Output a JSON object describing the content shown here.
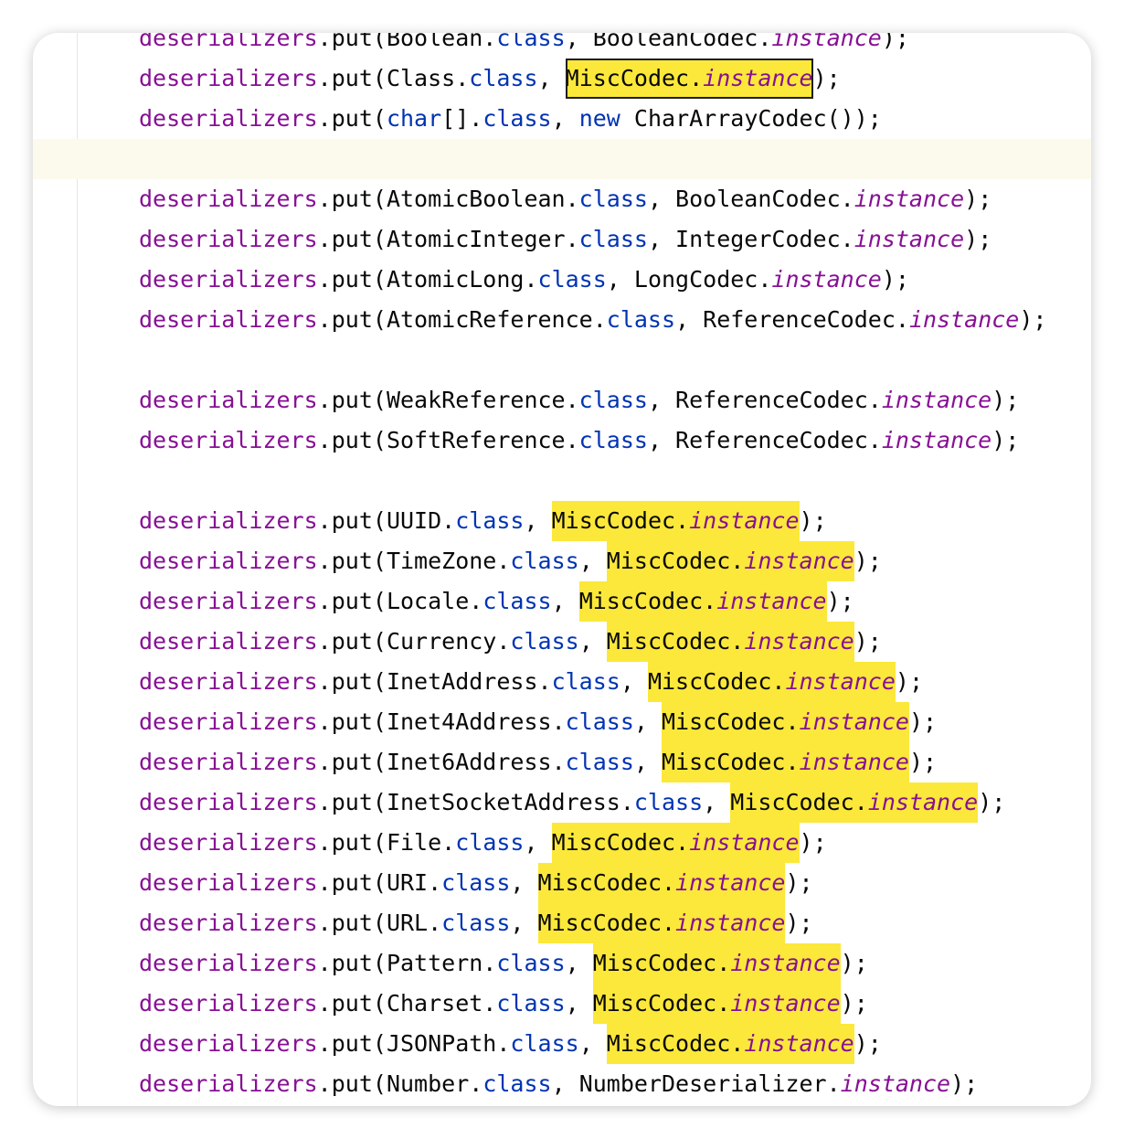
{
  "code_lines": [
    {
      "var": "deserializers",
      "call": ".put(",
      "type": "Boolean",
      "dot": ".",
      "cls": "class",
      "sep": ", ",
      "codec": "BooleanCodec.",
      "field": "instance",
      "end": ");",
      "kw_prefix": "",
      "highlight": "none"
    },
    {
      "var": "deserializers",
      "call": ".put(",
      "type": "Class",
      "dot": ".",
      "cls": "class",
      "sep": ", ",
      "codec": "MiscCodec.",
      "field": "instance",
      "end": ");",
      "kw_prefix": "",
      "highlight": "selected"
    },
    {
      "var": "deserializers",
      "call": ".put(",
      "type_kw": "char",
      "type": "[]",
      "dot": ".",
      "cls": "class",
      "sep": ", ",
      "new_kw": "new",
      "codec_new": " CharArrayCodec()",
      "end": ");",
      "highlight": "none"
    },
    {
      "blank": true,
      "current": true
    },
    {
      "var": "deserializers",
      "call": ".put(",
      "type": "AtomicBoolean",
      "dot": ".",
      "cls": "class",
      "sep": ", ",
      "codec": "BooleanCodec.",
      "field": "instance",
      "end": ");",
      "highlight": "none"
    },
    {
      "var": "deserializers",
      "call": ".put(",
      "type": "AtomicInteger",
      "dot": ".",
      "cls": "class",
      "sep": ", ",
      "codec": "IntegerCodec.",
      "field": "instance",
      "end": ");",
      "highlight": "none"
    },
    {
      "var": "deserializers",
      "call": ".put(",
      "type": "AtomicLong",
      "dot": ".",
      "cls": "class",
      "sep": ", ",
      "codec": "LongCodec.",
      "field": "instance",
      "end": ");",
      "highlight": "none"
    },
    {
      "var": "deserializers",
      "call": ".put(",
      "type": "AtomicReference",
      "dot": ".",
      "cls": "class",
      "sep": ", ",
      "codec": "ReferenceCodec.",
      "field": "instance",
      "end": ");",
      "highlight": "none"
    },
    {
      "blank": true
    },
    {
      "var": "deserializers",
      "call": ".put(",
      "type": "WeakReference",
      "dot": ".",
      "cls": "class",
      "sep": ", ",
      "codec": "ReferenceCodec.",
      "field": "instance",
      "end": ");",
      "highlight": "none"
    },
    {
      "var": "deserializers",
      "call": ".put(",
      "type": "SoftReference",
      "dot": ".",
      "cls": "class",
      "sep": ", ",
      "codec": "ReferenceCodec.",
      "field": "instance",
      "end": ");",
      "highlight": "none"
    },
    {
      "blank": true
    },
    {
      "var": "deserializers",
      "call": ".put(",
      "type": "UUID",
      "dot": ".",
      "cls": "class",
      "sep": ", ",
      "codec": "MiscCodec.",
      "field": "instance",
      "end": ");",
      "highlight": "yellow"
    },
    {
      "var": "deserializers",
      "call": ".put(",
      "type": "TimeZone",
      "dot": ".",
      "cls": "class",
      "sep": ", ",
      "codec": "MiscCodec.",
      "field": "instance",
      "end": ");",
      "highlight": "yellow"
    },
    {
      "var": "deserializers",
      "call": ".put(",
      "type": "Locale",
      "dot": ".",
      "cls": "class",
      "sep": ", ",
      "codec": "MiscCodec.",
      "field": "instance",
      "end": ");",
      "highlight": "yellow"
    },
    {
      "var": "deserializers",
      "call": ".put(",
      "type": "Currency",
      "dot": ".",
      "cls": "class",
      "sep": ", ",
      "codec": "MiscCodec.",
      "field": "instance",
      "end": ");",
      "highlight": "yellow"
    },
    {
      "var": "deserializers",
      "call": ".put(",
      "type": "InetAddress",
      "dot": ".",
      "cls": "class",
      "sep": ", ",
      "codec": "MiscCodec.",
      "field": "instance",
      "end": ");",
      "highlight": "yellow"
    },
    {
      "var": "deserializers",
      "call": ".put(",
      "type": "Inet4Address",
      "dot": ".",
      "cls": "class",
      "sep": ", ",
      "codec": "MiscCodec.",
      "field": "instance",
      "end": ");",
      "highlight": "yellow"
    },
    {
      "var": "deserializers",
      "call": ".put(",
      "type": "Inet6Address",
      "dot": ".",
      "cls": "class",
      "sep": ", ",
      "codec": "MiscCodec.",
      "field": "instance",
      "end": ");",
      "highlight": "yellow"
    },
    {
      "var": "deserializers",
      "call": ".put(",
      "type": "InetSocketAddress",
      "dot": ".",
      "cls": "class",
      "sep": ", ",
      "codec": "MiscCodec.",
      "field": "instance",
      "end": ");",
      "highlight": "yellow"
    },
    {
      "var": "deserializers",
      "call": ".put(",
      "type": "File",
      "dot": ".",
      "cls": "class",
      "sep": ", ",
      "codec": "MiscCodec.",
      "field": "instance",
      "end": ");",
      "highlight": "yellow"
    },
    {
      "var": "deserializers",
      "call": ".put(",
      "type": "URI",
      "dot": ".",
      "cls": "class",
      "sep": ", ",
      "codec": "MiscCodec.",
      "field": "instance",
      "end": ");",
      "highlight": "yellow"
    },
    {
      "var": "deserializers",
      "call": ".put(",
      "type": "URL",
      "dot": ".",
      "cls": "class",
      "sep": ", ",
      "codec": "MiscCodec.",
      "field": "instance",
      "end": ");",
      "highlight": "yellow"
    },
    {
      "var": "deserializers",
      "call": ".put(",
      "type": "Pattern",
      "dot": ".",
      "cls": "class",
      "sep": ", ",
      "codec": "MiscCodec.",
      "field": "instance",
      "end": ");",
      "highlight": "yellow"
    },
    {
      "var": "deserializers",
      "call": ".put(",
      "type": "Charset",
      "dot": ".",
      "cls": "class",
      "sep": ", ",
      "codec": "MiscCodec.",
      "field": "instance",
      "end": ");",
      "highlight": "yellow"
    },
    {
      "var": "deserializers",
      "call": ".put(",
      "type": "JSONPath",
      "dot": ".",
      "cls": "class",
      "sep": ", ",
      "codec": "MiscCodec.",
      "field": "instance",
      "end": ");",
      "highlight": "yellow"
    },
    {
      "var": "deserializers",
      "call": ".put(",
      "type": "Number",
      "dot": ".",
      "cls": "class",
      "sep": ", ",
      "codec": "NumberDeserializer.",
      "field": "instance",
      "end": ");",
      "highlight": "none"
    }
  ],
  "colors": {
    "identifier": "#871094",
    "keyword": "#0033b3",
    "text": "#080808",
    "search_highlight": "#fbe83a",
    "current_line": "#fcfaed"
  }
}
